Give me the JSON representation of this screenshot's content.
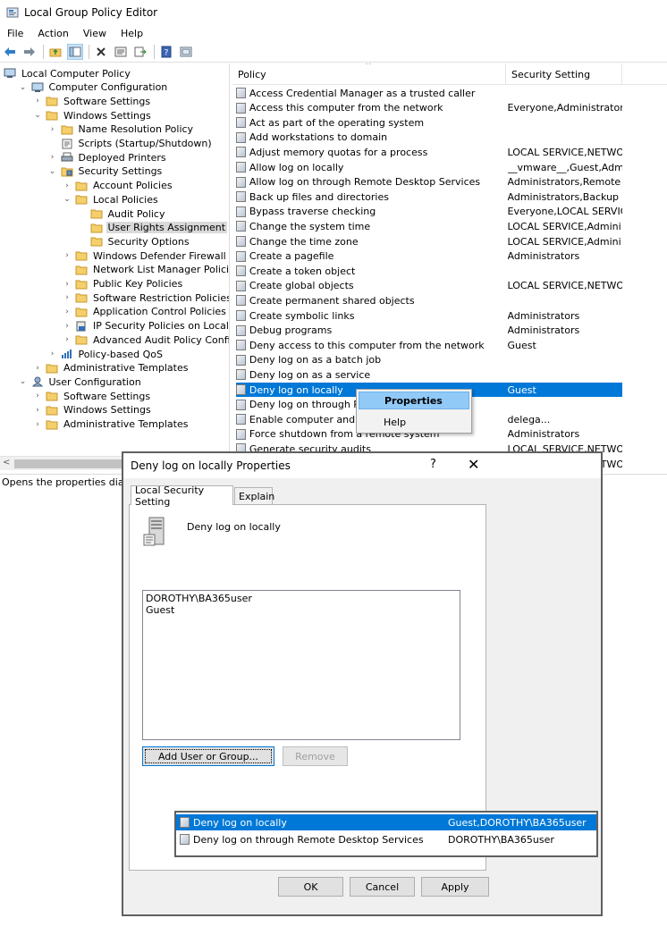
{
  "window": {
    "title": "Local Group Policy Editor"
  },
  "menu": [
    "File",
    "Action",
    "View",
    "Help"
  ],
  "tree": [
    {
      "label": "Local Computer Policy",
      "depth": 0,
      "icon": "computer-icon",
      "exp": ""
    },
    {
      "label": "Computer Configuration",
      "depth": 1,
      "icon": "computer-icon",
      "exp": "open"
    },
    {
      "label": "Software Settings",
      "depth": 2,
      "icon": "folder-icon",
      "exp": "closed"
    },
    {
      "label": "Windows Settings",
      "depth": 2,
      "icon": "folder-icon",
      "exp": "open"
    },
    {
      "label": "Name Resolution Policy",
      "depth": 3,
      "icon": "folder-icon",
      "exp": "closed"
    },
    {
      "label": "Scripts (Startup/Shutdown)",
      "depth": 3,
      "icon": "script-icon",
      "exp": ""
    },
    {
      "label": "Deployed Printers",
      "depth": 3,
      "icon": "printer-icon",
      "exp": "closed"
    },
    {
      "label": "Security Settings",
      "depth": 3,
      "icon": "security-icon",
      "exp": "open"
    },
    {
      "label": "Account Policies",
      "depth": 4,
      "icon": "folder-icon",
      "exp": "closed"
    },
    {
      "label": "Local Policies",
      "depth": 4,
      "icon": "folder-icon",
      "exp": "open"
    },
    {
      "label": "Audit Policy",
      "depth": 5,
      "icon": "folder-icon",
      "exp": ""
    },
    {
      "label": "User Rights Assignment",
      "depth": 5,
      "icon": "folder-icon",
      "exp": "",
      "selected": true
    },
    {
      "label": "Security Options",
      "depth": 5,
      "icon": "folder-icon",
      "exp": ""
    },
    {
      "label": "Windows Defender Firewall with Adv",
      "depth": 4,
      "icon": "folder-icon",
      "exp": "closed"
    },
    {
      "label": "Network List Manager Policies",
      "depth": 4,
      "icon": "folder-icon",
      "exp": ""
    },
    {
      "label": "Public Key Policies",
      "depth": 4,
      "icon": "folder-icon",
      "exp": "closed"
    },
    {
      "label": "Software Restriction Policies",
      "depth": 4,
      "icon": "folder-icon",
      "exp": "closed"
    },
    {
      "label": "Application Control Policies",
      "depth": 4,
      "icon": "folder-icon",
      "exp": "closed"
    },
    {
      "label": "IP Security Policies on Local Compu",
      "depth": 4,
      "icon": "ipsec-icon",
      "exp": "closed"
    },
    {
      "label": "Advanced Audit Policy Configuratio",
      "depth": 4,
      "icon": "folder-icon",
      "exp": "closed"
    },
    {
      "label": "Policy-based QoS",
      "depth": 3,
      "icon": "qos-icon",
      "exp": "closed"
    },
    {
      "label": "Administrative Templates",
      "depth": 2,
      "icon": "folder-icon",
      "exp": "closed"
    },
    {
      "label": "User Configuration",
      "depth": 1,
      "icon": "user-icon",
      "exp": "open"
    },
    {
      "label": "Software Settings",
      "depth": 2,
      "icon": "folder-icon",
      "exp": "closed"
    },
    {
      "label": "Windows Settings",
      "depth": 2,
      "icon": "folder-icon",
      "exp": "closed"
    },
    {
      "label": "Administrative Templates",
      "depth": 2,
      "icon": "folder-icon",
      "exp": "closed"
    }
  ],
  "list": {
    "columns": [
      "Policy",
      "Security Setting"
    ],
    "rows": [
      {
        "policy": "Access Credential Manager as a trusted caller",
        "setting": ""
      },
      {
        "policy": "Access this computer from the network",
        "setting": "Everyone,Administrators..."
      },
      {
        "policy": "Act as part of the operating system",
        "setting": ""
      },
      {
        "policy": "Add workstations to domain",
        "setting": ""
      },
      {
        "policy": "Adjust memory quotas for a process",
        "setting": "LOCAL SERVICE,NETWO..."
      },
      {
        "policy": "Allow log on locally",
        "setting": "__vmware__,Guest,Admi..."
      },
      {
        "policy": "Allow log on through Remote Desktop Services",
        "setting": "Administrators,Remote ..."
      },
      {
        "policy": "Back up files and directories",
        "setting": "Administrators,Backup ..."
      },
      {
        "policy": "Bypass traverse checking",
        "setting": "Everyone,LOCAL SERVIC..."
      },
      {
        "policy": "Change the system time",
        "setting": "LOCAL SERVICE,Admini..."
      },
      {
        "policy": "Change the time zone",
        "setting": "LOCAL SERVICE,Admini..."
      },
      {
        "policy": "Create a pagefile",
        "setting": "Administrators"
      },
      {
        "policy": "Create a token object",
        "setting": ""
      },
      {
        "policy": "Create global objects",
        "setting": "LOCAL SERVICE,NETWO..."
      },
      {
        "policy": "Create permanent shared objects",
        "setting": ""
      },
      {
        "policy": "Create symbolic links",
        "setting": "Administrators"
      },
      {
        "policy": "Debug programs",
        "setting": "Administrators"
      },
      {
        "policy": "Deny access to this computer from the network",
        "setting": "Guest"
      },
      {
        "policy": "Deny log on as a batch job",
        "setting": ""
      },
      {
        "policy": "Deny log on as a service",
        "setting": ""
      },
      {
        "policy": "Deny log on locally",
        "setting": "Guest",
        "selected": true
      },
      {
        "policy": "Deny log on through Rem",
        "setting": ""
      },
      {
        "policy": "Enable computer and use",
        "setting": "delega..."
      },
      {
        "policy": "Force shutdown from a remote system",
        "setting": "Administrators"
      },
      {
        "policy": "Generate security audits",
        "setting": "LOCAL SERVICE,NETWO..."
      },
      {
        "policy": "",
        "setting": "LOCAL SERVICE,NETWO..."
      }
    ]
  },
  "context_menu": {
    "items": [
      "Properties",
      "Help"
    ]
  },
  "status": {
    "text": "Opens the properties dialog b"
  },
  "dialog": {
    "title": "Deny log on locally Properties",
    "help_glyph": "?",
    "close_glyph": "✕",
    "tabs": [
      "Local Security Setting",
      "Explain"
    ],
    "policy_name": "Deny log on locally",
    "accounts": [
      "DOROTHY\\BA365user",
      "Guest"
    ],
    "add_button": "Add User or Group...",
    "remove_button": "Remove",
    "ok_button": "OK",
    "cancel_button": "Cancel",
    "apply_button": "Apply"
  },
  "inset_list": [
    {
      "policy": "Deny log on locally",
      "setting": "Guest,DOROTHY\\BA365user",
      "selected": true
    },
    {
      "policy": "Deny log on through Remote Desktop Services",
      "setting": "DOROTHY\\BA365user"
    }
  ]
}
